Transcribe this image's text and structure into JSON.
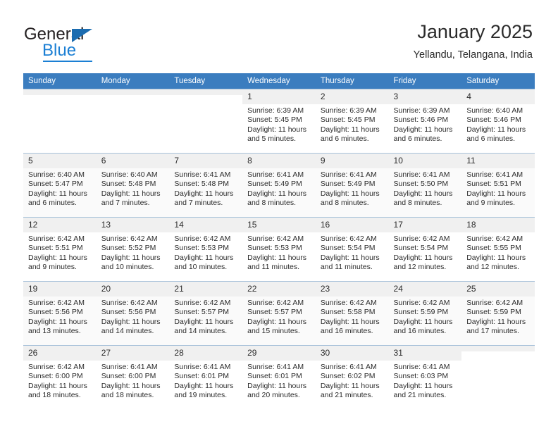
{
  "brand": {
    "name_top": "General",
    "name_bottom": "Blue",
    "accent_color": "#1b7fd4",
    "triangle_color": "#1b6cb0"
  },
  "header": {
    "month_title": "January 2025",
    "location": "Yellandu, Telangana, India"
  },
  "calendar": {
    "header_bg": "#3b7dbf",
    "weekday_headers": [
      "Sunday",
      "Monday",
      "Tuesday",
      "Wednesday",
      "Thursday",
      "Friday",
      "Saturday"
    ],
    "weeks": [
      [
        {
          "day": "",
          "detail": ""
        },
        {
          "day": "",
          "detail": ""
        },
        {
          "day": "",
          "detail": ""
        },
        {
          "day": "1",
          "detail": "Sunrise: 6:39 AM\nSunset: 5:45 PM\nDaylight: 11 hours\nand 5 minutes."
        },
        {
          "day": "2",
          "detail": "Sunrise: 6:39 AM\nSunset: 5:45 PM\nDaylight: 11 hours\nand 6 minutes."
        },
        {
          "day": "3",
          "detail": "Sunrise: 6:39 AM\nSunset: 5:46 PM\nDaylight: 11 hours\nand 6 minutes."
        },
        {
          "day": "4",
          "detail": "Sunrise: 6:40 AM\nSunset: 5:46 PM\nDaylight: 11 hours\nand 6 minutes."
        }
      ],
      [
        {
          "day": "5",
          "detail": "Sunrise: 6:40 AM\nSunset: 5:47 PM\nDaylight: 11 hours\nand 6 minutes."
        },
        {
          "day": "6",
          "detail": "Sunrise: 6:40 AM\nSunset: 5:48 PM\nDaylight: 11 hours\nand 7 minutes."
        },
        {
          "day": "7",
          "detail": "Sunrise: 6:41 AM\nSunset: 5:48 PM\nDaylight: 11 hours\nand 7 minutes."
        },
        {
          "day": "8",
          "detail": "Sunrise: 6:41 AM\nSunset: 5:49 PM\nDaylight: 11 hours\nand 8 minutes."
        },
        {
          "day": "9",
          "detail": "Sunrise: 6:41 AM\nSunset: 5:49 PM\nDaylight: 11 hours\nand 8 minutes."
        },
        {
          "day": "10",
          "detail": "Sunrise: 6:41 AM\nSunset: 5:50 PM\nDaylight: 11 hours\nand 8 minutes."
        },
        {
          "day": "11",
          "detail": "Sunrise: 6:41 AM\nSunset: 5:51 PM\nDaylight: 11 hours\nand 9 minutes."
        }
      ],
      [
        {
          "day": "12",
          "detail": "Sunrise: 6:42 AM\nSunset: 5:51 PM\nDaylight: 11 hours\nand 9 minutes."
        },
        {
          "day": "13",
          "detail": "Sunrise: 6:42 AM\nSunset: 5:52 PM\nDaylight: 11 hours\nand 10 minutes."
        },
        {
          "day": "14",
          "detail": "Sunrise: 6:42 AM\nSunset: 5:53 PM\nDaylight: 11 hours\nand 10 minutes."
        },
        {
          "day": "15",
          "detail": "Sunrise: 6:42 AM\nSunset: 5:53 PM\nDaylight: 11 hours\nand 11 minutes."
        },
        {
          "day": "16",
          "detail": "Sunrise: 6:42 AM\nSunset: 5:54 PM\nDaylight: 11 hours\nand 11 minutes."
        },
        {
          "day": "17",
          "detail": "Sunrise: 6:42 AM\nSunset: 5:54 PM\nDaylight: 11 hours\nand 12 minutes."
        },
        {
          "day": "18",
          "detail": "Sunrise: 6:42 AM\nSunset: 5:55 PM\nDaylight: 11 hours\nand 12 minutes."
        }
      ],
      [
        {
          "day": "19",
          "detail": "Sunrise: 6:42 AM\nSunset: 5:56 PM\nDaylight: 11 hours\nand 13 minutes."
        },
        {
          "day": "20",
          "detail": "Sunrise: 6:42 AM\nSunset: 5:56 PM\nDaylight: 11 hours\nand 14 minutes."
        },
        {
          "day": "21",
          "detail": "Sunrise: 6:42 AM\nSunset: 5:57 PM\nDaylight: 11 hours\nand 14 minutes."
        },
        {
          "day": "22",
          "detail": "Sunrise: 6:42 AM\nSunset: 5:57 PM\nDaylight: 11 hours\nand 15 minutes."
        },
        {
          "day": "23",
          "detail": "Sunrise: 6:42 AM\nSunset: 5:58 PM\nDaylight: 11 hours\nand 16 minutes."
        },
        {
          "day": "24",
          "detail": "Sunrise: 6:42 AM\nSunset: 5:59 PM\nDaylight: 11 hours\nand 16 minutes."
        },
        {
          "day": "25",
          "detail": "Sunrise: 6:42 AM\nSunset: 5:59 PM\nDaylight: 11 hours\nand 17 minutes."
        }
      ],
      [
        {
          "day": "26",
          "detail": "Sunrise: 6:42 AM\nSunset: 6:00 PM\nDaylight: 11 hours\nand 18 minutes."
        },
        {
          "day": "27",
          "detail": "Sunrise: 6:41 AM\nSunset: 6:00 PM\nDaylight: 11 hours\nand 18 minutes."
        },
        {
          "day": "28",
          "detail": "Sunrise: 6:41 AM\nSunset: 6:01 PM\nDaylight: 11 hours\nand 19 minutes."
        },
        {
          "day": "29",
          "detail": "Sunrise: 6:41 AM\nSunset: 6:01 PM\nDaylight: 11 hours\nand 20 minutes."
        },
        {
          "day": "30",
          "detail": "Sunrise: 6:41 AM\nSunset: 6:02 PM\nDaylight: 11 hours\nand 21 minutes."
        },
        {
          "day": "31",
          "detail": "Sunrise: 6:41 AM\nSunset: 6:03 PM\nDaylight: 11 hours\nand 21 minutes."
        },
        {
          "day": "",
          "detail": ""
        }
      ]
    ]
  }
}
